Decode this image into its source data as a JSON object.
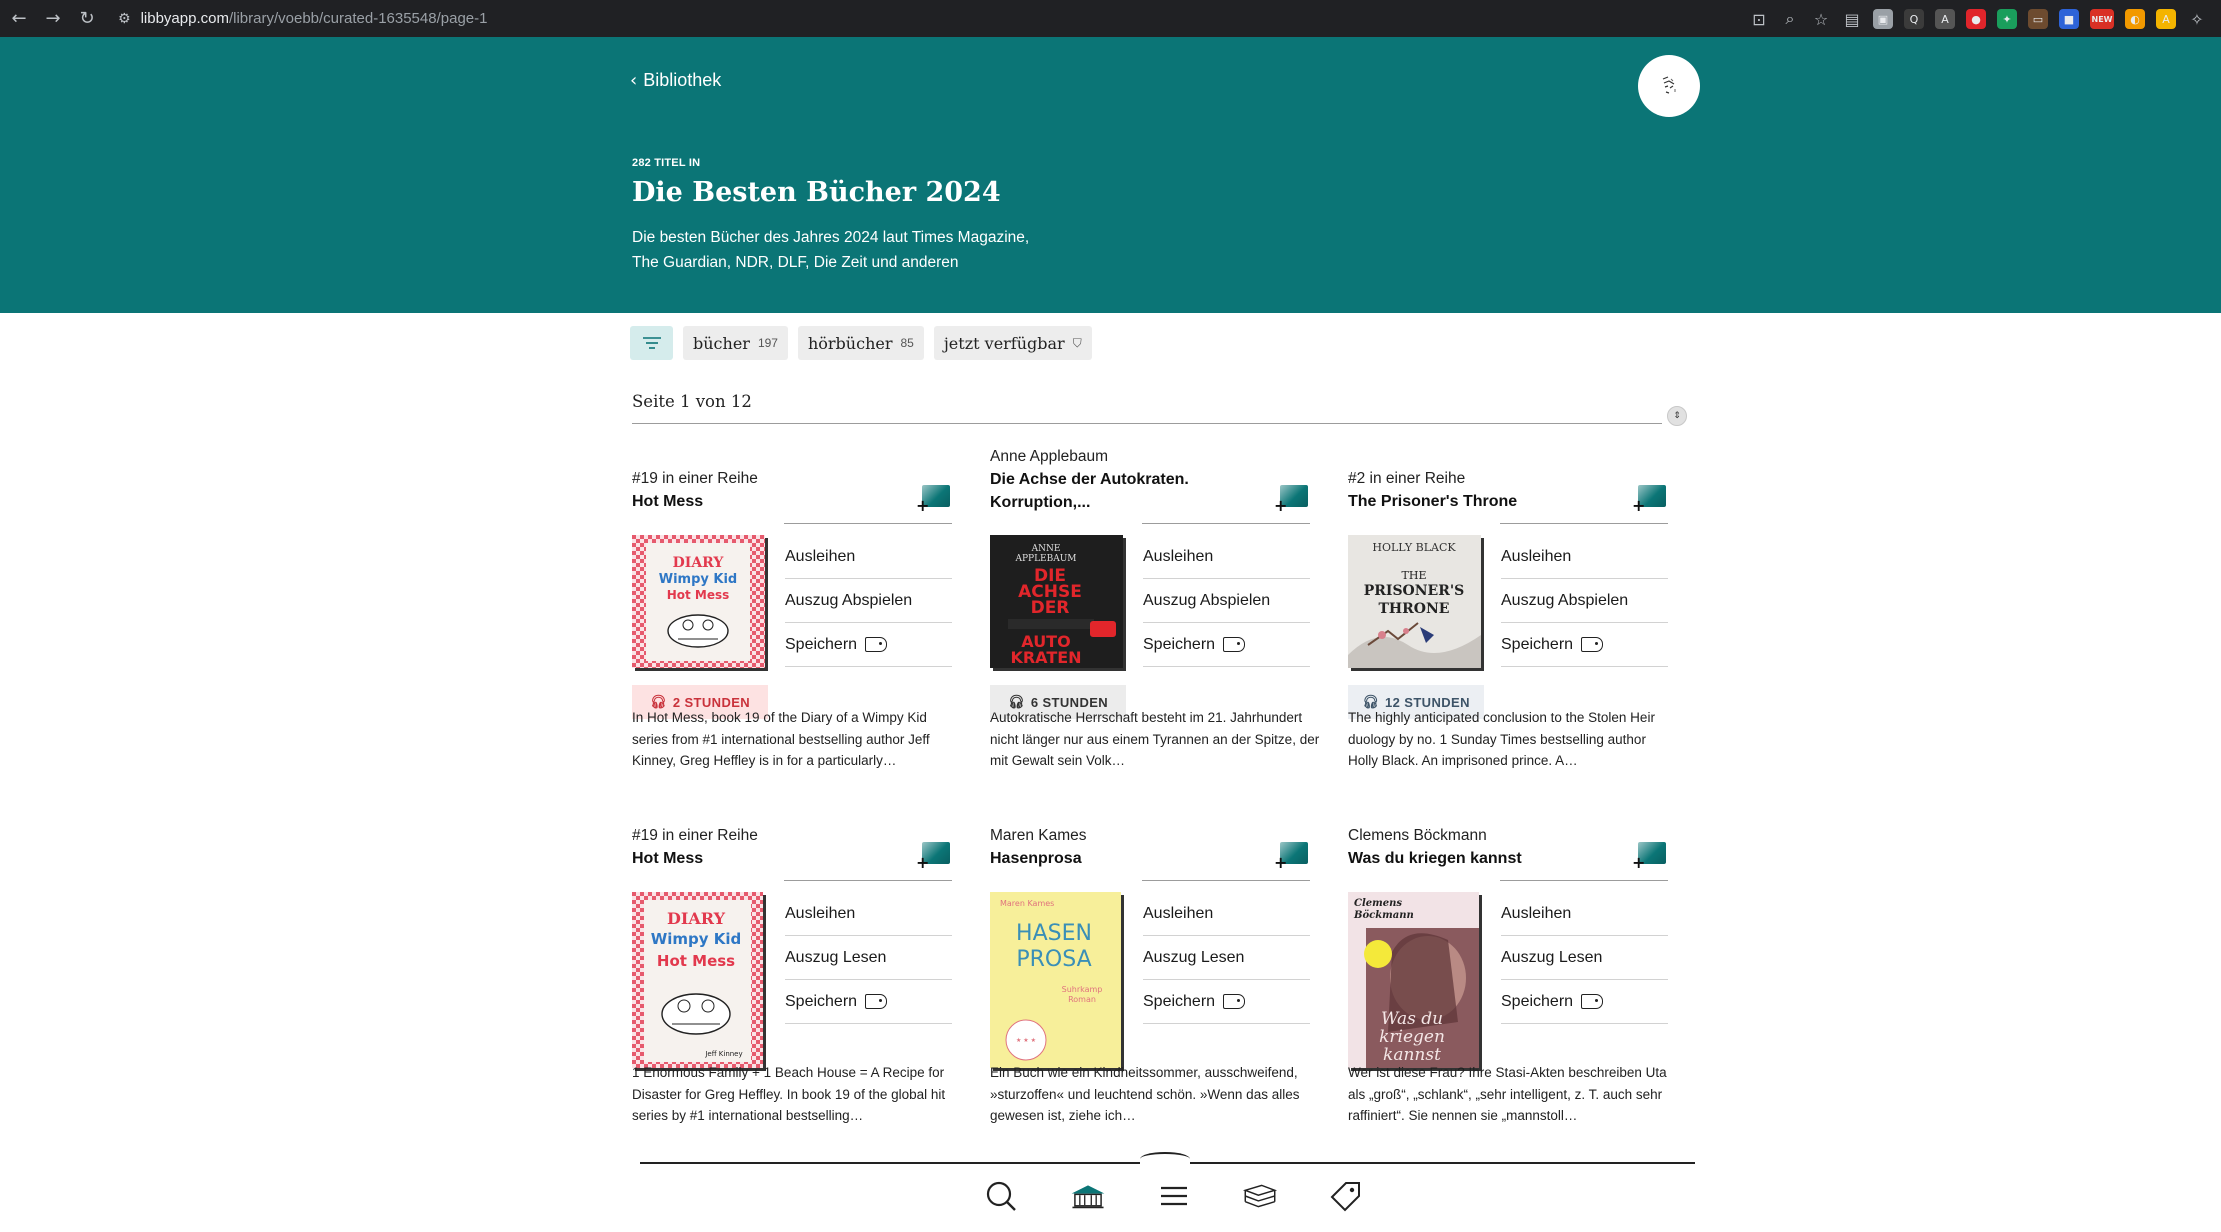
{
  "browser": {
    "url_host": "libbyapp.com",
    "url_path": "/library/voebb/curated-1635548/page-1",
    "extensions": [
      {
        "name": "install-app-icon",
        "glyph": "⊡"
      },
      {
        "name": "zoom-icon",
        "glyph": "⌕"
      },
      {
        "name": "bookmark-star-icon",
        "glyph": "☆"
      },
      {
        "name": "reader-mode-icon",
        "glyph": "▤"
      },
      {
        "name": "ext-a-icon",
        "glyph": "▣",
        "color": "#9aa0a6"
      },
      {
        "name": "ext-b-icon",
        "glyph": "Q",
        "color": "#3b3b3b"
      },
      {
        "name": "ext-c-icon",
        "glyph": "A",
        "color": "#555"
      },
      {
        "name": "ext-d-icon",
        "glyph": "●",
        "color": "#e0252b"
      },
      {
        "name": "ext-e-icon",
        "glyph": "✦",
        "color": "#1a9e5c"
      },
      {
        "name": "ext-f-icon",
        "glyph": "▭",
        "color": "#6d4b2f"
      },
      {
        "name": "ext-g-icon",
        "glyph": "■",
        "color": "#2d63d8"
      },
      {
        "name": "ext-h-icon",
        "glyph": "NEW",
        "color": "#d93025"
      },
      {
        "name": "ext-i-icon",
        "glyph": "◐",
        "color": "#f29900"
      },
      {
        "name": "ext-j-icon",
        "glyph": "A",
        "color": "#f4b400"
      },
      {
        "name": "extensions-puzzle-icon",
        "glyph": "✧"
      }
    ]
  },
  "header": {
    "back_label": "Bibliothek",
    "count_label": "282 TITEL IN",
    "title": "Die Besten Bücher 2024",
    "description": "Die besten Bücher des Jahres 2024 laut Times Magazine, The Guardian, NDR, DLF, Die Zeit und anderen"
  },
  "filters": {
    "books_label": "bücher",
    "books_count": "197",
    "audio_label": "hörbücher",
    "audio_count": "85",
    "available_label": "jetzt verfügbar"
  },
  "pager": {
    "label": "Seite 1 von 12"
  },
  "books": [
    {
      "meta": "#19 in einer Reihe",
      "title": "Hot Mess",
      "actions": [
        "Ausleihen",
        "Auszug Abspielen",
        "Speichern"
      ],
      "badge": "2 STUNDEN",
      "blurb": "In Hot Mess, book 19 of the Diary of a Wimpy Kid series from #1 international bestselling author Jeff Kinney, Greg Heffley is in for a particularly…"
    },
    {
      "meta": "Anne Applebaum",
      "title": "Die Achse der Autokraten. Korruption,...",
      "actions": [
        "Ausleihen",
        "Auszug Abspielen",
        "Speichern"
      ],
      "badge": "6 STUNDEN",
      "blurb": "Autokratische Herrschaft besteht im 21. Jahrhundert nicht länger nur aus einem Tyrannen an der Spitze, der mit Gewalt sein Volk…",
      "cover_text": [
        "ANNE",
        "APPLEBAUM",
        "DIE",
        "ACHSE",
        "DER",
        "AUTO",
        "KRATEN"
      ]
    },
    {
      "meta": "#2 in einer Reihe",
      "title": "The Prisoner's Throne",
      "actions": [
        "Ausleihen",
        "Auszug Abspielen",
        "Speichern"
      ],
      "badge": "12 STUNDEN",
      "blurb": "The highly anticipated conclusion to the Stolen Heir duology by no. 1 Sunday Times bestselling author Holly Black. An imprisoned prince. A…",
      "cover_text": [
        "HOLLY BLACK",
        "THE",
        "PRISONER'S",
        "THRONE"
      ]
    },
    {
      "meta": "#19 in einer Reihe",
      "title": "Hot Mess",
      "actions": [
        "Ausleihen",
        "Auszug Lesen",
        "Speichern"
      ],
      "blurb": "1 Enormous Family + 1 Beach House = A Recipe for Disaster for Greg Heffley. In book 19 of the global hit series by #1 international bestselling…",
      "cover_text": [
        "DIARY",
        "Wimpy Kid",
        "Hot Mess",
        "Jeff Kinney"
      ]
    },
    {
      "meta": "Maren Kames",
      "title": "Hasenprosa",
      "actions": [
        "Ausleihen",
        "Auszug Lesen",
        "Speichern"
      ],
      "blurb": "Ein Buch wie ein Kindheitssommer, ausschweifend, »sturzoffen« und leuchtend schön. »Wenn das alles gewesen ist, ziehe ich…",
      "cover_text": [
        "Maren Kames",
        "HASEN",
        "PROSA",
        "Suhrkamp",
        "Roman"
      ]
    },
    {
      "meta": "Clemens Böckmann",
      "title": "Was du kriegen kannst",
      "actions": [
        "Ausleihen",
        "Auszug Lesen",
        "Speichern"
      ],
      "blurb": "Wer ist diese Frau? Ihre Stasi-Akten beschreiben Uta als „groß“, „schlank“, „sehr intelligent, z. T. auch sehr raffiniert“. Sie nennen sie „mannstoll…",
      "cover_text": [
        "Clemens",
        "Böckmann",
        "Was du",
        "kriegen",
        "kannst"
      ]
    }
  ],
  "colors": {
    "brand_teal": "#0b7576",
    "badge_red": "#c9323b"
  }
}
